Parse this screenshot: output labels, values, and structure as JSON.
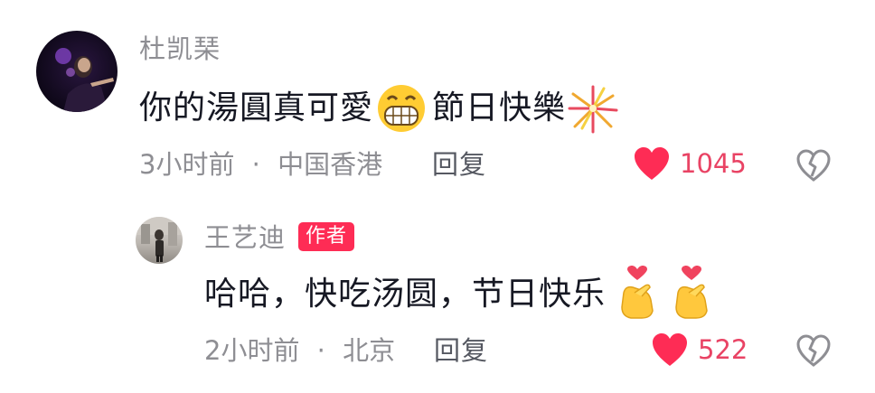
{
  "comment": {
    "username": "杜凯琹",
    "text": "你的湯圓真可愛",
    "text_2": "節日快樂",
    "time": "3小时前",
    "location": "中国香港",
    "separator": "·",
    "reply_label": "回复",
    "likes": "1045",
    "emoji": [
      "grinning-face-icon",
      "fireworks-icon"
    ]
  },
  "reply": {
    "username": "王艺迪",
    "badge": "作者",
    "text": "哈哈，快吃汤圆，节日快乐",
    "time": "2小时前",
    "location": "北京",
    "separator": "·",
    "reply_label": "回复",
    "likes": "522",
    "emoji": [
      "heart-hands-icon",
      "heart-hands-icon"
    ]
  },
  "colors": {
    "like_red": "#fe2c55",
    "meta_gray": "#8e8e93",
    "badge_bg": "#fe2c55"
  }
}
